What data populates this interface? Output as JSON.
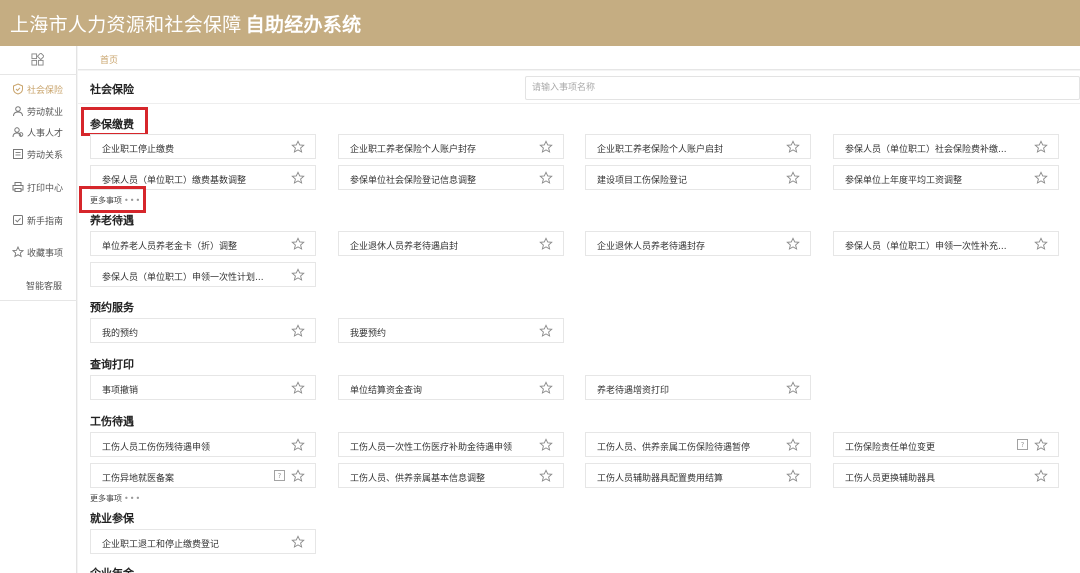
{
  "header": {
    "title_main": "上海市人力资源和社会保障",
    "title_bold": "自助经办系统"
  },
  "sidebar": {
    "items": [
      {
        "label": "社会保险",
        "icon": "shield-icon",
        "active": true
      },
      {
        "label": "劳动就业",
        "icon": "person-icon"
      },
      {
        "label": "人事人才",
        "icon": "people-icon"
      },
      {
        "label": "劳动关系",
        "icon": "document-icon"
      },
      {
        "label": "打印中心",
        "icon": "printer-icon"
      },
      {
        "label": "新手指南",
        "icon": "guide-icon"
      },
      {
        "label": "收藏事项",
        "icon": "star-icon"
      },
      {
        "label": "智能客服",
        "icon": ""
      }
    ]
  },
  "breadcrumb": {
    "home": "首页"
  },
  "main": {
    "title": "社会保险",
    "search_placeholder": "请输入事项名称",
    "more_label": "更多事项",
    "sections": [
      {
        "title": "参保缴费",
        "items": [
          "企业职工停止缴费",
          "企业职工养老保险个人账户封存",
          "企业职工养老保险个人账户启封",
          "参保人员（单位职工）社会保险费补缴...",
          "参保人员（单位职工）缴费基数调整",
          "参保单位社会保险登记信息调整",
          "建设项目工伤保险登记",
          "参保单位上年度平均工资调整"
        ]
      },
      {
        "title": "养老待遇",
        "items": [
          "单位养老人员养老金卡（折）调整",
          "企业退休人员养老待遇启封",
          "企业退休人员养老待遇封存",
          "参保人员（单位职工）申领一次性补充...",
          "参保人员（单位职工）申领一次性计划..."
        ]
      },
      {
        "title": "预约服务",
        "items": [
          "我的预约",
          "我要预约"
        ]
      },
      {
        "title": "查询打印",
        "items": [
          "事项撤销",
          "单位结算资金查询",
          "养老待遇增资打印"
        ]
      },
      {
        "title": "工伤待遇",
        "items": [
          "工伤人员工伤伤残待遇申领",
          "工伤人员一次性工伤医疗补助金待遇申领",
          "工伤人员、供养亲属工伤保险待遇暂停",
          "工伤保险责任单位变更",
          "工伤异地就医备案",
          "工伤人员、供养亲属基本信息调整",
          "工伤人员辅助器具配置费用结算",
          "工伤人员更换辅助器具"
        ]
      },
      {
        "title": "就业参保",
        "items": [
          "企业职工退工和停止缴费登记"
        ]
      },
      {
        "title": "企业年金",
        "items": []
      }
    ]
  },
  "colors": {
    "header_bg": "#c5ad82",
    "accent": "#c9a46c",
    "highlight_border": "#d6262b"
  }
}
